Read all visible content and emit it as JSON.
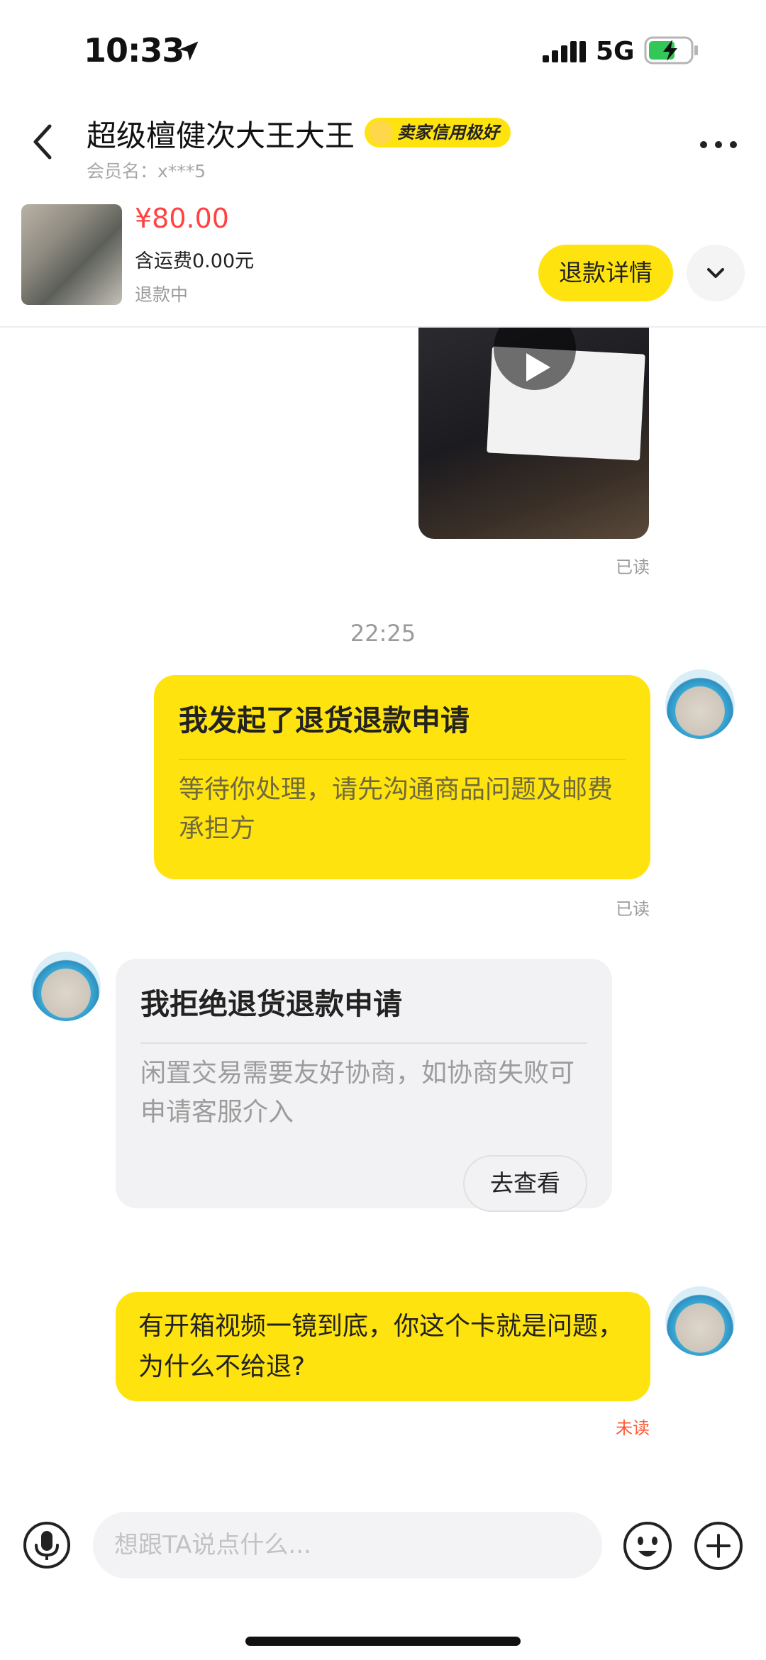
{
  "status_bar": {
    "time": "10:33",
    "network": "5G",
    "icons": [
      "location-arrow-icon",
      "signal-icon",
      "battery-charging-icon"
    ]
  },
  "header": {
    "seller_name": "超级檀健次大王大王",
    "credit_badge": "卖家信用极好",
    "member_name": "会员名：x***5"
  },
  "product": {
    "price": "¥80.00",
    "shipping": "含运费0.00元",
    "status": "退款中",
    "detail_button": "退款详情"
  },
  "chat": {
    "video_read": "已读",
    "time_divider": "22:25",
    "message1": {
      "title": "我发起了退货退款申请",
      "desc": "等待你处理，请先沟通商品问题及邮费承担方",
      "read": "已读"
    },
    "message2": {
      "title": "我拒绝退货退款申请",
      "desc": "闲置交易需要友好协商，如协商失败可申请客服介入",
      "button": "去查看"
    },
    "message3": {
      "text": "有开箱视频一镜到底，你这个卡就是问题，为什么不给退?",
      "read": "未读"
    }
  },
  "input": {
    "placeholder": "想跟TA说点什么..."
  },
  "colors": {
    "accent_yellow": "#ffe30f",
    "price_red": "#ff4242",
    "unread_red": "#ff5a36",
    "card_gray": "#f2f2f4"
  }
}
